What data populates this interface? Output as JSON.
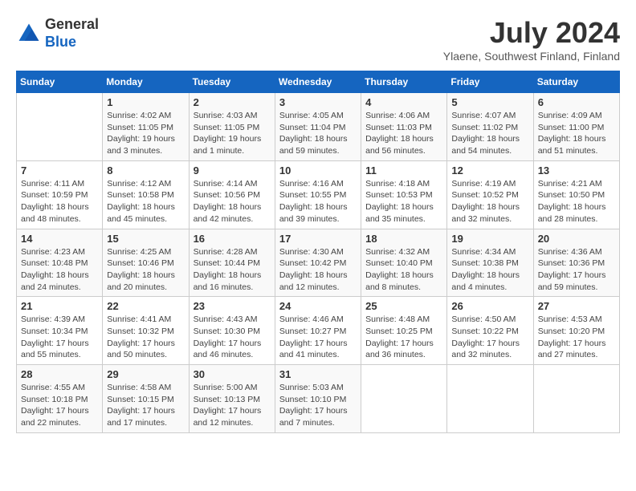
{
  "header": {
    "logo_general": "General",
    "logo_blue": "Blue",
    "month_title": "July 2024",
    "location": "Ylaene, Southwest Finland, Finland"
  },
  "days_of_week": [
    "Sunday",
    "Monday",
    "Tuesday",
    "Wednesday",
    "Thursday",
    "Friday",
    "Saturday"
  ],
  "weeks": [
    [
      {
        "day": "",
        "info": ""
      },
      {
        "day": "1",
        "info": "Sunrise: 4:02 AM\nSunset: 11:05 PM\nDaylight: 19 hours\nand 3 minutes."
      },
      {
        "day": "2",
        "info": "Sunrise: 4:03 AM\nSunset: 11:05 PM\nDaylight: 19 hours\nand 1 minute."
      },
      {
        "day": "3",
        "info": "Sunrise: 4:05 AM\nSunset: 11:04 PM\nDaylight: 18 hours\nand 59 minutes."
      },
      {
        "day": "4",
        "info": "Sunrise: 4:06 AM\nSunset: 11:03 PM\nDaylight: 18 hours\nand 56 minutes."
      },
      {
        "day": "5",
        "info": "Sunrise: 4:07 AM\nSunset: 11:02 PM\nDaylight: 18 hours\nand 54 minutes."
      },
      {
        "day": "6",
        "info": "Sunrise: 4:09 AM\nSunset: 11:00 PM\nDaylight: 18 hours\nand 51 minutes."
      }
    ],
    [
      {
        "day": "7",
        "info": "Sunrise: 4:11 AM\nSunset: 10:59 PM\nDaylight: 18 hours\nand 48 minutes."
      },
      {
        "day": "8",
        "info": "Sunrise: 4:12 AM\nSunset: 10:58 PM\nDaylight: 18 hours\nand 45 minutes."
      },
      {
        "day": "9",
        "info": "Sunrise: 4:14 AM\nSunset: 10:56 PM\nDaylight: 18 hours\nand 42 minutes."
      },
      {
        "day": "10",
        "info": "Sunrise: 4:16 AM\nSunset: 10:55 PM\nDaylight: 18 hours\nand 39 minutes."
      },
      {
        "day": "11",
        "info": "Sunrise: 4:18 AM\nSunset: 10:53 PM\nDaylight: 18 hours\nand 35 minutes."
      },
      {
        "day": "12",
        "info": "Sunrise: 4:19 AM\nSunset: 10:52 PM\nDaylight: 18 hours\nand 32 minutes."
      },
      {
        "day": "13",
        "info": "Sunrise: 4:21 AM\nSunset: 10:50 PM\nDaylight: 18 hours\nand 28 minutes."
      }
    ],
    [
      {
        "day": "14",
        "info": "Sunrise: 4:23 AM\nSunset: 10:48 PM\nDaylight: 18 hours\nand 24 minutes."
      },
      {
        "day": "15",
        "info": "Sunrise: 4:25 AM\nSunset: 10:46 PM\nDaylight: 18 hours\nand 20 minutes."
      },
      {
        "day": "16",
        "info": "Sunrise: 4:28 AM\nSunset: 10:44 PM\nDaylight: 18 hours\nand 16 minutes."
      },
      {
        "day": "17",
        "info": "Sunrise: 4:30 AM\nSunset: 10:42 PM\nDaylight: 18 hours\nand 12 minutes."
      },
      {
        "day": "18",
        "info": "Sunrise: 4:32 AM\nSunset: 10:40 PM\nDaylight: 18 hours\nand 8 minutes."
      },
      {
        "day": "19",
        "info": "Sunrise: 4:34 AM\nSunset: 10:38 PM\nDaylight: 18 hours\nand 4 minutes."
      },
      {
        "day": "20",
        "info": "Sunrise: 4:36 AM\nSunset: 10:36 PM\nDaylight: 17 hours\nand 59 minutes."
      }
    ],
    [
      {
        "day": "21",
        "info": "Sunrise: 4:39 AM\nSunset: 10:34 PM\nDaylight: 17 hours\nand 55 minutes."
      },
      {
        "day": "22",
        "info": "Sunrise: 4:41 AM\nSunset: 10:32 PM\nDaylight: 17 hours\nand 50 minutes."
      },
      {
        "day": "23",
        "info": "Sunrise: 4:43 AM\nSunset: 10:30 PM\nDaylight: 17 hours\nand 46 minutes."
      },
      {
        "day": "24",
        "info": "Sunrise: 4:46 AM\nSunset: 10:27 PM\nDaylight: 17 hours\nand 41 minutes."
      },
      {
        "day": "25",
        "info": "Sunrise: 4:48 AM\nSunset: 10:25 PM\nDaylight: 17 hours\nand 36 minutes."
      },
      {
        "day": "26",
        "info": "Sunrise: 4:50 AM\nSunset: 10:22 PM\nDaylight: 17 hours\nand 32 minutes."
      },
      {
        "day": "27",
        "info": "Sunrise: 4:53 AM\nSunset: 10:20 PM\nDaylight: 17 hours\nand 27 minutes."
      }
    ],
    [
      {
        "day": "28",
        "info": "Sunrise: 4:55 AM\nSunset: 10:18 PM\nDaylight: 17 hours\nand 22 minutes."
      },
      {
        "day": "29",
        "info": "Sunrise: 4:58 AM\nSunset: 10:15 PM\nDaylight: 17 hours\nand 17 minutes."
      },
      {
        "day": "30",
        "info": "Sunrise: 5:00 AM\nSunset: 10:13 PM\nDaylight: 17 hours\nand 12 minutes."
      },
      {
        "day": "31",
        "info": "Sunrise: 5:03 AM\nSunset: 10:10 PM\nDaylight: 17 hours\nand 7 minutes."
      },
      {
        "day": "",
        "info": ""
      },
      {
        "day": "",
        "info": ""
      },
      {
        "day": "",
        "info": ""
      }
    ]
  ]
}
